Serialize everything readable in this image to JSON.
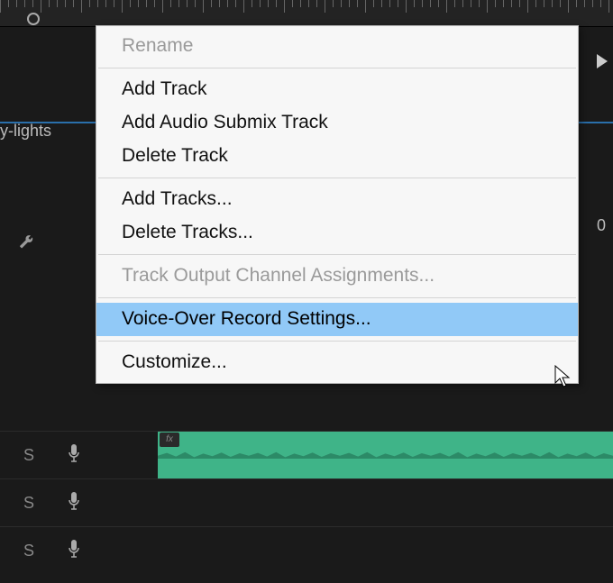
{
  "track_label": "y-lights",
  "right_number": "0",
  "audio_rows": [
    {
      "solo": "S",
      "mic": true
    },
    {
      "solo": "S",
      "mic": true
    },
    {
      "solo": "S",
      "mic": true
    }
  ],
  "fx_label": "fx",
  "context_menu": {
    "items": [
      {
        "label": "Rename",
        "disabled": true,
        "sep_after": true
      },
      {
        "label": "Add Track",
        "disabled": false
      },
      {
        "label": "Add Audio Submix Track",
        "disabled": false
      },
      {
        "label": "Delete Track",
        "disabled": false,
        "sep_after": true
      },
      {
        "label": "Add Tracks...",
        "disabled": false
      },
      {
        "label": "Delete Tracks...",
        "disabled": false,
        "sep_after": true
      },
      {
        "label": "Track Output Channel Assignments...",
        "disabled": true,
        "sep_after": true
      },
      {
        "label": "Voice-Over Record Settings...",
        "disabled": false,
        "highlighted": true,
        "sep_after": true
      },
      {
        "label": "Customize...",
        "disabled": false
      }
    ]
  }
}
